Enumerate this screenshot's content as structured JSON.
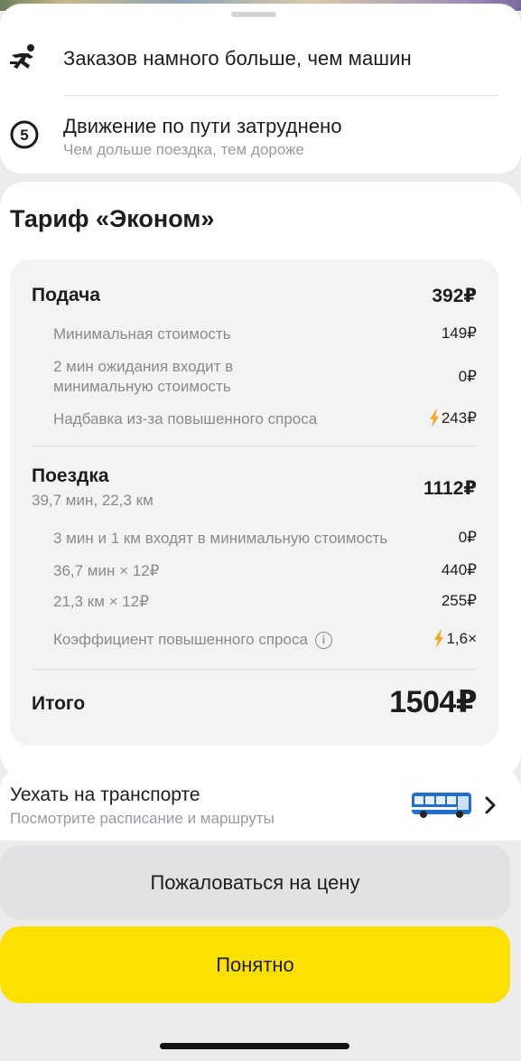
{
  "notices": [
    {
      "title": "Заказов намного больше, чем машин",
      "icon": "running-person-icon"
    },
    {
      "title": "Движение по пути затруднено",
      "subtitle": "Чем дольше поездка, тем дороже",
      "icon": "traffic-level-icon",
      "icon_text": "5"
    }
  ],
  "tariff": {
    "title": "Тариф «Эконом»",
    "pickup": {
      "label": "Подача",
      "value": "392₽",
      "lines": [
        {
          "label": "Минимальная стоимость",
          "value": "149₽"
        },
        {
          "label": "2 мин ожидания входит в\nминимальную стоимость",
          "value": "0₽"
        },
        {
          "label": "Надбавка из-за повышенного спроса",
          "value": "243₽",
          "surge_icon": "lightning-icon"
        }
      ]
    },
    "trip": {
      "label": "Поездка",
      "subtitle": "39,7 мин, 22,3 км",
      "value": "1112₽",
      "lines": [
        {
          "label": "3 мин и 1 км входят в минимальную стоимость",
          "value": "0₽"
        },
        {
          "label": "36,7 мин × 12₽",
          "value": "440₽"
        },
        {
          "label": "21,3 км × 12₽",
          "value": "255₽"
        },
        {
          "label": "Коэффициент повышенного спроса",
          "value": "1,6×",
          "surge_icon": "lightning-icon",
          "info_icon": "i"
        }
      ]
    },
    "total": {
      "label": "Итого",
      "value": "1504₽"
    }
  },
  "transport": {
    "title": "Уехать на транспорте",
    "subtitle": "Посмотрите расписание и маршруты"
  },
  "buttons": {
    "complain": "Пожаловаться на цену",
    "ok": "Понятно"
  },
  "colors": {
    "accent_yellow": "#fce000",
    "surge_orange": "#f5a623"
  }
}
